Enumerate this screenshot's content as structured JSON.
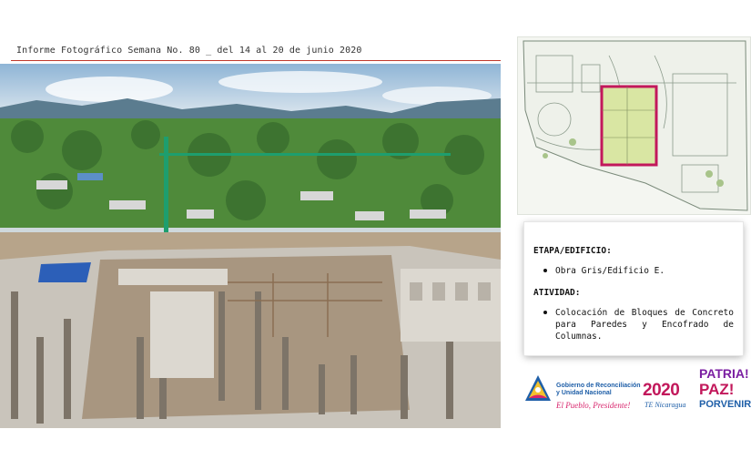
{
  "header": {
    "title": "Informe Fotográfico Semana No. 80 _ del 14 al 20 de junio 2020"
  },
  "photo": {
    "subject": "construction-site-photo"
  },
  "site_map": {
    "highlight_color": "#c2185b"
  },
  "info": {
    "stage_label": "ETAPA/EDIFICIO:",
    "stage_items": [
      "Obra Gris/Edificio E."
    ],
    "activity_label": "ATIVIDAD:",
    "activity_items": [
      "Colocación de Bloques de Concreto para Paredes y Encofrado de Columnas."
    ]
  },
  "logos": {
    "government_line1": "Gobierno de Reconciliación",
    "government_line2": "y Unidad Nacional",
    "government_slogan": "El Pueblo, Presidente!",
    "year": "2020",
    "year_tagline": "TE Nicaragua",
    "patria_line1": "PATRIA!",
    "patria_line2": "PAZ!",
    "patria_line3": "PORVENIR!"
  },
  "colors": {
    "accent_red": "#c0392b",
    "brand_magenta": "#c2185b",
    "brand_blue": "#1f5fa8",
    "brand_purple": "#7b1fa2"
  }
}
